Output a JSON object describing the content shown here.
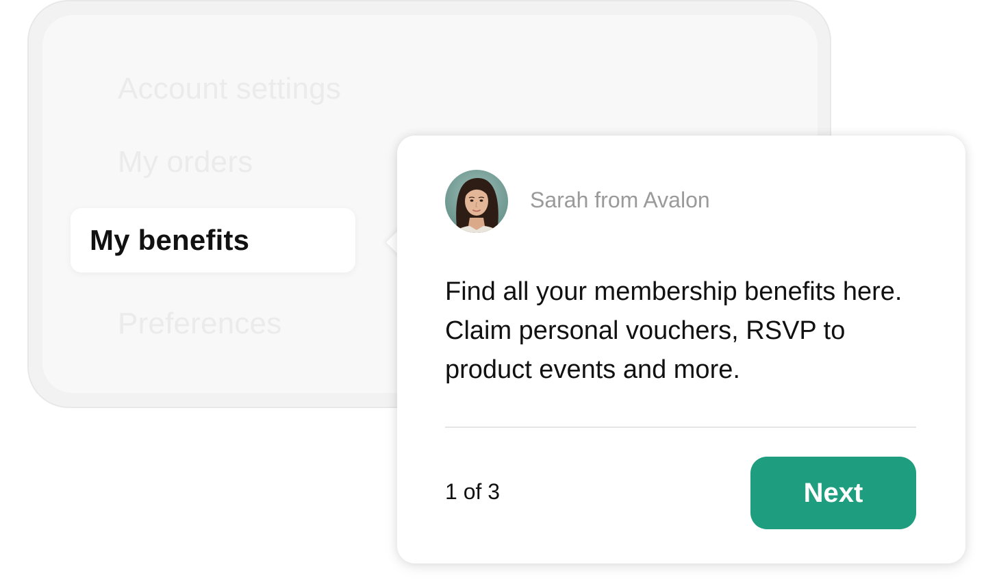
{
  "menu": {
    "items": [
      {
        "label": "Account settings"
      },
      {
        "label": "My orders"
      },
      {
        "label": "My benefits"
      },
      {
        "label": "Preferences"
      }
    ]
  },
  "tooltip": {
    "sender": "Sarah from Avalon",
    "avatar_icon": "person-avatar",
    "message": "Find all your membership benefits here. Claim personal vouchers, RSVP to product events and more.",
    "step_counter": "1 of 3",
    "next_label": "Next"
  },
  "colors": {
    "accent": "#1e9e7e",
    "panel_bg": "#f8f8f8",
    "muted_text": "#9a9a9a"
  }
}
